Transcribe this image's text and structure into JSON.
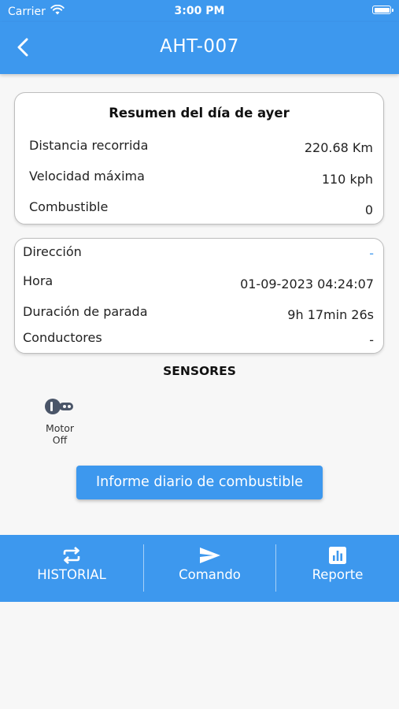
{
  "status_bar": {
    "carrier": "Carrier",
    "time": "3:00 PM"
  },
  "nav": {
    "title": "AHT-007"
  },
  "summary": {
    "title": "Resumen del día de ayer",
    "rows": [
      {
        "label": "Distancia recorrida",
        "value": "220.68 Km"
      },
      {
        "label": "Velocidad máxima",
        "value": "110 kph"
      },
      {
        "label": "Combustible",
        "value": "0"
      }
    ]
  },
  "details": {
    "rows": [
      {
        "label": "Dirección",
        "value": "-"
      },
      {
        "label": "Hora",
        "value": "01-09-2023 04:24:07"
      },
      {
        "label": "Duración de parada",
        "value": "9h 17min 26s"
      },
      {
        "label": "Conductores",
        "value": "-"
      }
    ]
  },
  "sensors": {
    "heading": "SENSORES",
    "items": [
      {
        "label_line1": "Motor",
        "label_line2": "Off",
        "icon": "ignition-key-icon"
      }
    ]
  },
  "fuel_report_button": {
    "label": "Informe diario de combustible"
  },
  "bottom_nav": {
    "items": [
      {
        "label": "HISTORIAL",
        "icon": "repeat-icon"
      },
      {
        "label": "Comando",
        "icon": "send-icon"
      },
      {
        "label": "Reporte",
        "icon": "bar-chart-icon"
      }
    ]
  },
  "colors": {
    "primary": "#3d98ee",
    "background": "#f7f7f7",
    "link_dash": "#3d98ee"
  }
}
